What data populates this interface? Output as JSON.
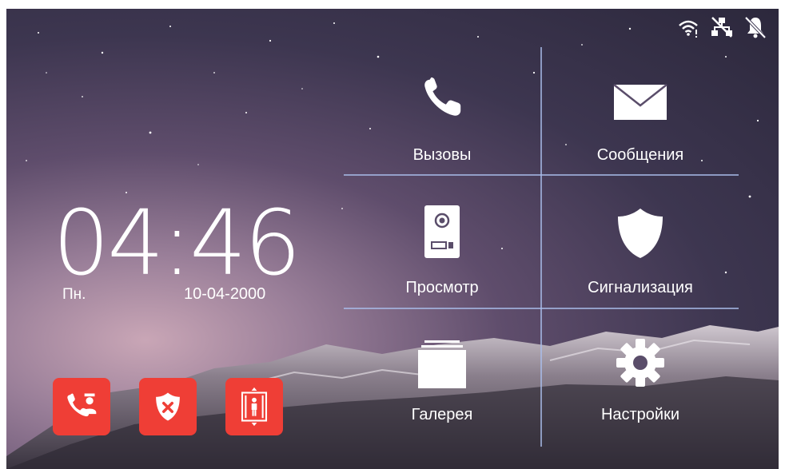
{
  "status": {
    "icons": [
      "wifi-icon",
      "network-icon",
      "bell-muted-icon"
    ]
  },
  "clock": {
    "time": "04:46",
    "day": "Пн.",
    "date": "10-04-2000"
  },
  "tiles": [
    {
      "label": "Вызовы",
      "icon": "phone-icon"
    },
    {
      "label": "Сообщения",
      "icon": "envelope-icon"
    },
    {
      "label": "Просмотр",
      "icon": "door-station-icon"
    },
    {
      "label": "Сигнализация",
      "icon": "shield-icon"
    },
    {
      "label": "Галерея",
      "icon": "gallery-stack-icon"
    },
    {
      "label": "Настройки",
      "icon": "gear-icon"
    }
  ],
  "quick_buttons": [
    {
      "icon": "call-guard-icon"
    },
    {
      "icon": "disarm-shield-icon"
    },
    {
      "icon": "elevator-icon"
    }
  ],
  "colors": {
    "accent_red": "#ef3e36",
    "text": "#ffffff",
    "grid_line": "#aabeeb"
  }
}
